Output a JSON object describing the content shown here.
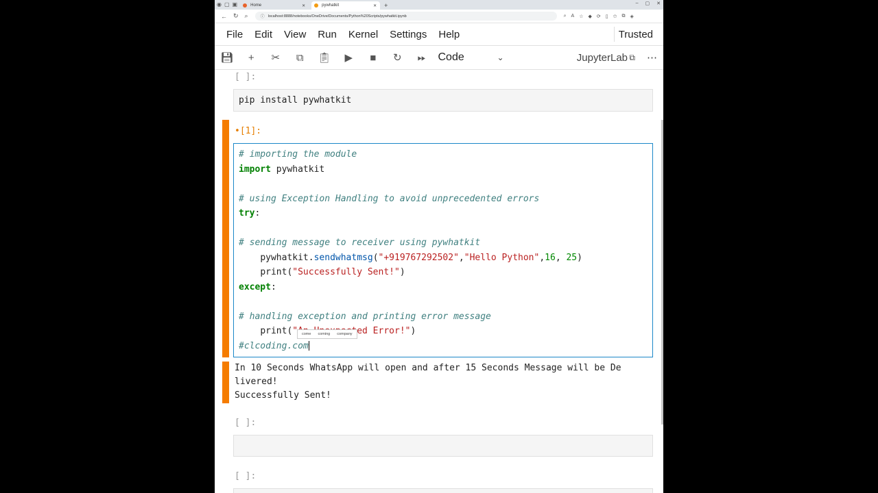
{
  "browser": {
    "tabs": [
      {
        "label": "Home",
        "active": false
      },
      {
        "label": "pywhatkit",
        "active": true
      }
    ],
    "url": "localhost:8888/notebooks/OneDrive/Documents/Python%20Scripts/pywhatkit.ipynb"
  },
  "menubar": {
    "items": [
      "File",
      "Edit",
      "View",
      "Run",
      "Kernel",
      "Settings",
      "Help"
    ],
    "trusted": "Trusted"
  },
  "toolbar": {
    "cell_type": "Code",
    "kernel_label": "JupyterLab"
  },
  "cells": {
    "cell1": {
      "prompt": "[ ]:",
      "code": "pip install pywhatkit"
    },
    "cell2": {
      "prompt": "•[1]:",
      "lines": [
        {
          "indent": "",
          "comment": "# importing the module"
        },
        {
          "keyword": "import",
          "text": " pywhatkit"
        },
        {
          "blank": ""
        },
        {
          "comment": "# using Exception Handling to avoid unprecedented errors"
        },
        {
          "keyword": "try",
          "text": ":"
        },
        {
          "blank": ""
        },
        {
          "comment": "# sending message to receiver using pywhatkit"
        },
        {
          "indent": "    ",
          "obj": "pywhatkit.",
          "fn": "sendwhatmsg",
          "open": "(",
          "s1": "\"+919767292502\"",
          "comma1": ",",
          "s2": "\"Hello Python\"",
          "comma2": ",",
          "n1": "16",
          "comma3": ", ",
          "n2": "25",
          "close": ")"
        },
        {
          "indent": "    ",
          "call": "print(",
          "s": "\"Successfully Sent!\"",
          "close": ")"
        },
        {
          "keyword": "except",
          "text": ":"
        },
        {
          "blank": ""
        },
        {
          "comment": "# handling exception and printing error message"
        },
        {
          "indent": "    ",
          "call": "print(",
          "s": "\"An Unexpected Error!\"",
          "close": ")"
        },
        {
          "comment": "#clcoding.com"
        }
      ],
      "suggestions": [
        "come",
        "coming",
        "company"
      ],
      "output": "In 10 Seconds WhatsApp will open and after 15 Seconds Message will be De\nlivered!\nSuccessfully Sent!"
    },
    "cell3": {
      "prompt": "[ ]:"
    },
    "cell4": {
      "prompt": "[ ]:"
    }
  }
}
